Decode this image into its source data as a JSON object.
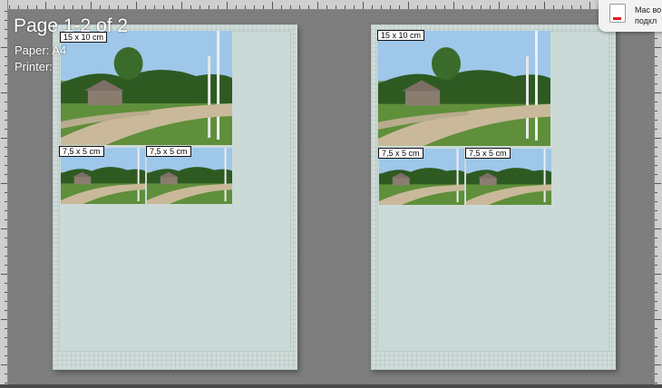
{
  "overlay": {
    "title": "Page 1-2 of 2",
    "paper_label": "Paper:",
    "paper_value": "A4",
    "printer_label": "Printer:"
  },
  "notification": {
    "line1": "Mac во",
    "line2": "подкл"
  },
  "pages": [
    {
      "large_label": "15 x 10 cm",
      "small_labels": [
        "7,5 x 5 cm",
        "7,5 x 5 cm"
      ]
    },
    {
      "large_label": "15 x 10 cm",
      "small_labels": [
        "7,5 x 5 cm",
        "7,5 x 5 cm"
      ]
    }
  ],
  "colors": {
    "canvas": "#7e7e7e",
    "sheet": "#cfdcd9",
    "alert_red": "#e02020"
  }
}
